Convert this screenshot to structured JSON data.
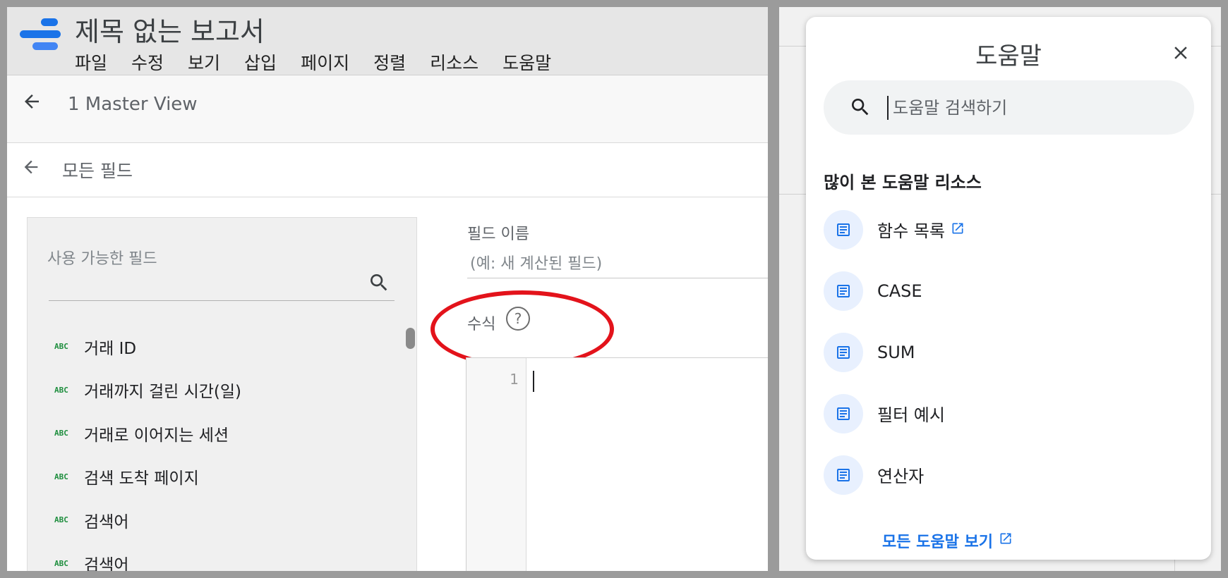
{
  "colors": {
    "brand_blue": "#1a73e8",
    "annotation_red": "#e3131b",
    "field_type_green": "#1e8e3e"
  },
  "header": {
    "title": "제목 없는 보고서",
    "menu": [
      "파일",
      "수정",
      "보기",
      "삽입",
      "페이지",
      "정렬",
      "리소스",
      "도움말"
    ]
  },
  "nav": {
    "view_label": "1 Master View",
    "back_label": "모든 필드"
  },
  "fields_panel": {
    "header": "사용 가능한 필드",
    "type_badge": "ABC",
    "items": [
      "거래 ID",
      "거래까지 걸린 시간(일)",
      "거래로 이어지는 세션",
      "검색 도착 페이지",
      "검색어",
      "검색어"
    ]
  },
  "form": {
    "field_name_label": "필드 이름",
    "field_name_placeholder": "(예: 새 계산된 필드)",
    "formula_label": "수식",
    "help_icon_text": "?",
    "line_number": "1"
  },
  "help_panel": {
    "title": "도움말",
    "search_placeholder": "도움말 검색하기",
    "section_title": "많이 본 도움말 리소스",
    "resources": [
      "함수 목록",
      "CASE",
      "SUM",
      "필터 예시",
      "연산자"
    ],
    "see_all": "모든 도움말 보기"
  },
  "icons": [
    "back-arrow-icon",
    "search-icon",
    "help-circle-icon",
    "close-icon",
    "article-icon",
    "open-in-new-icon"
  ]
}
